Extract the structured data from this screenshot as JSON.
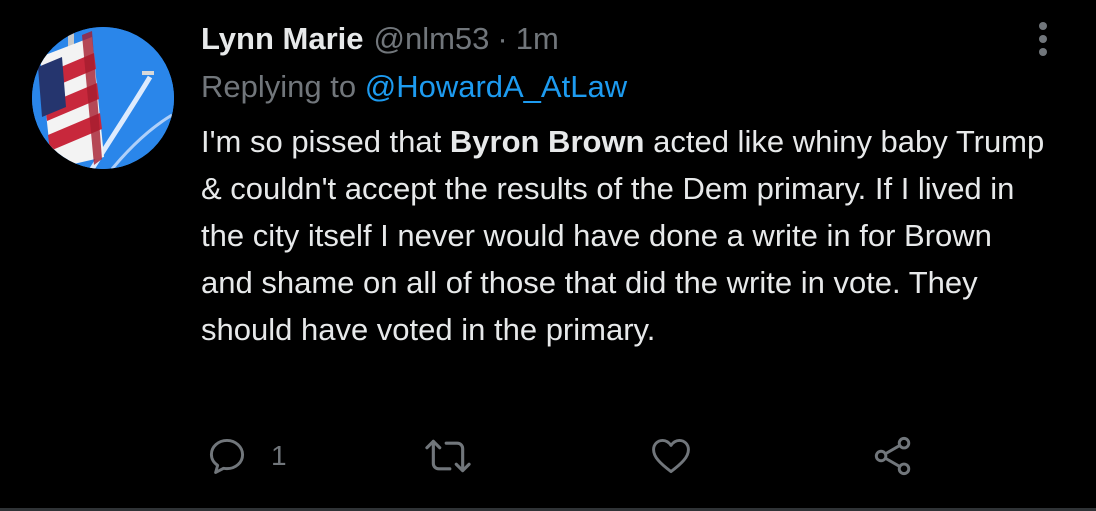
{
  "tweet": {
    "author": {
      "display_name": "Lynn Marie",
      "handle": "@nlm53",
      "separator": "·",
      "timestamp": "1m"
    },
    "reply_prefix": "Replying to",
    "reply_to": "@HowardA_AtLaw",
    "text": {
      "part1": "I'm so pissed that ",
      "bold": "Byron Brown",
      "part2": " acted like whiny baby Trump & couldn't accept the results of the Dem primary. If I lived in the city itself I never would have done a write in for Brown and shame on all of those that did the write in vote. They should have voted in the primary."
    },
    "actions": {
      "reply_count": "1",
      "reply_icon": "reply-icon",
      "retweet_icon": "retweet-icon",
      "like_icon": "heart-icon",
      "share_icon": "share-icon"
    },
    "more_icon": "more-vertical-icon"
  },
  "colors": {
    "background": "#000000",
    "primary_text": "#e7e9ea",
    "secondary_text": "#71767b",
    "link": "#1d9bf0"
  }
}
